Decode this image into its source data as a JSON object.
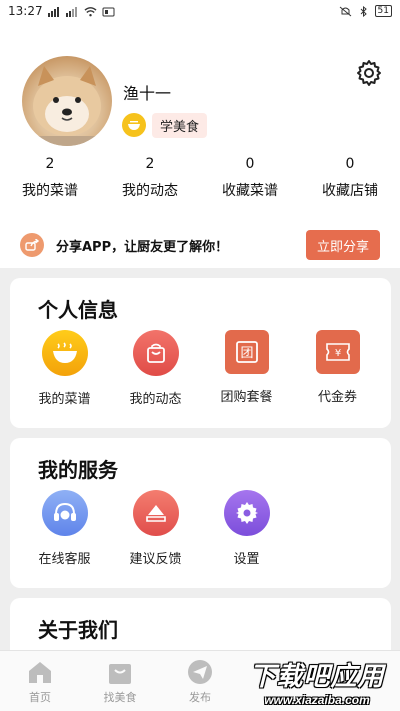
{
  "status_bar": {
    "time": "13:27",
    "battery": "51"
  },
  "profile": {
    "username": "渔十一",
    "level_label": "学美食"
  },
  "stats": [
    {
      "count": "2",
      "label": "我的菜谱"
    },
    {
      "count": "2",
      "label": "我的动态"
    },
    {
      "count": "0",
      "label": "收藏菜谱"
    },
    {
      "count": "0",
      "label": "收藏店铺"
    }
  ],
  "share": {
    "text": "分享APP，让厨友更了解你！",
    "button": "立即分享"
  },
  "personal": {
    "title": "个人信息",
    "items": [
      {
        "label": "我的菜谱",
        "icon": "recipe-bowl-icon"
      },
      {
        "label": "我的动态",
        "icon": "shopping-bag-icon"
      },
      {
        "label": "团购套餐",
        "icon": "group-buy-icon"
      },
      {
        "label": "代金券",
        "icon": "voucher-icon"
      }
    ]
  },
  "services": {
    "title": "我的服务",
    "items": [
      {
        "label": "在线客服",
        "icon": "headset-icon"
      },
      {
        "label": "建议反馈",
        "icon": "feedback-icon"
      },
      {
        "label": "设置",
        "icon": "gear-icon"
      }
    ]
  },
  "about": {
    "title": "关于我们"
  },
  "bottom_nav": [
    {
      "label": "首页",
      "icon": "home-icon"
    },
    {
      "label": "找美食",
      "icon": "bag-icon"
    },
    {
      "label": "发布",
      "icon": "send-icon"
    }
  ],
  "watermark": {
    "main": "下载吧应用",
    "sub": "www.xiazaiba.com"
  },
  "colors": {
    "accent": "#e66d4e",
    "background_grey": "#eeeeee",
    "level_icon": "#f6c21c"
  }
}
